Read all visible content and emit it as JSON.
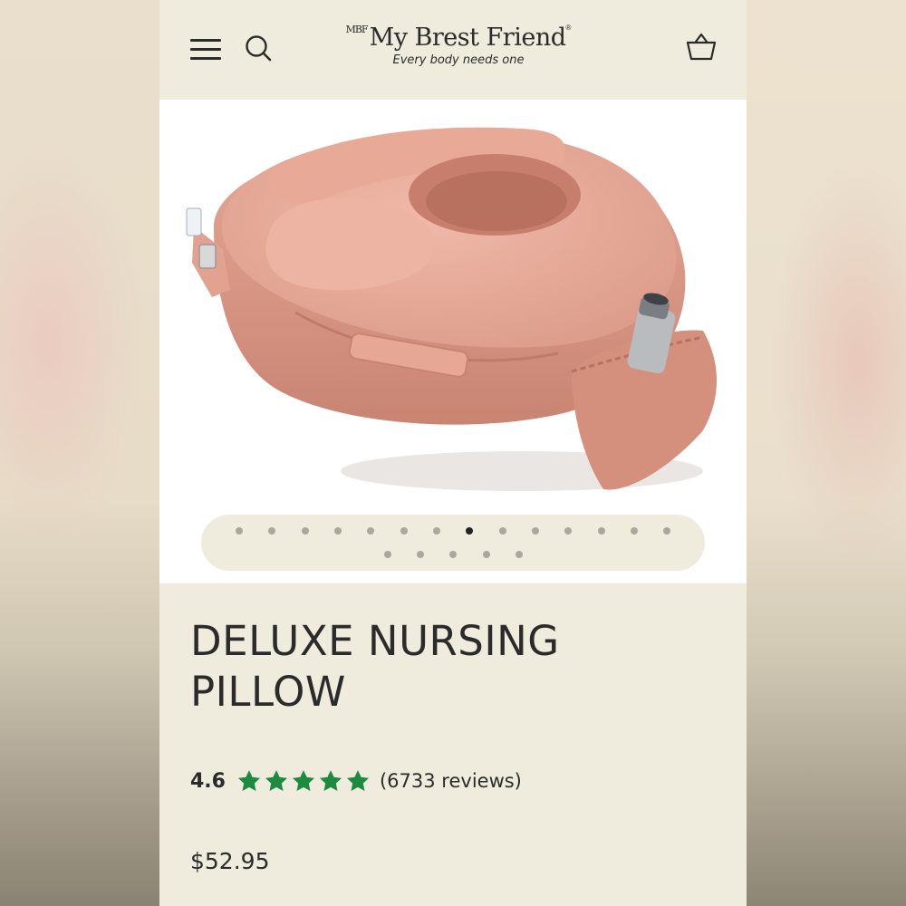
{
  "brand": {
    "mark": "MBF",
    "name": "My Brest Friend",
    "registered": "®",
    "tagline": "Every body needs one"
  },
  "icons": {
    "menu": "hamburger-menu-icon",
    "search": "search-icon",
    "cart": "shopping-basket-icon"
  },
  "gallery": {
    "image_description": "pink nursing pillow with side pocket holding a water bottle",
    "total_slides": 19,
    "active_slide": 8
  },
  "product": {
    "title": "DELUXE NURSING PILLOW",
    "rating": "4.6",
    "stars_filled": 5,
    "review_count": "(6733 reviews)",
    "price": "$52.95"
  },
  "colors": {
    "background": "#efecdd",
    "star": "#1c8a3f",
    "text": "#2b2b2b",
    "pillow": "#e2a393"
  }
}
